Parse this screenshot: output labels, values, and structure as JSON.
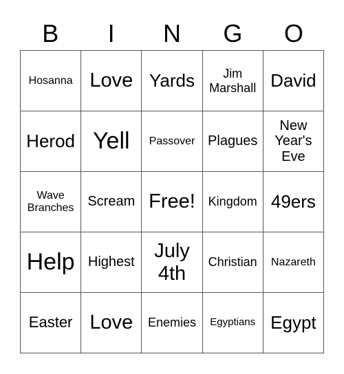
{
  "header": [
    "B",
    "I",
    "N",
    "G",
    "O"
  ],
  "grid": [
    [
      {
        "text": "Hosanna",
        "size": "s-xs"
      },
      {
        "text": "Love",
        "size": "s-l"
      },
      {
        "text": "Yards",
        "size": "s-lm"
      },
      {
        "text": "Jim Marshall",
        "size": "s-s"
      },
      {
        "text": "David",
        "size": "s-lm"
      }
    ],
    [
      {
        "text": "Herod",
        "size": "s-lm"
      },
      {
        "text": "Yell",
        "size": "s-xl"
      },
      {
        "text": "Passover",
        "size": "s-xs"
      },
      {
        "text": "Plagues",
        "size": "s-ms"
      },
      {
        "text": "New Year's Eve",
        "size": "s-ms"
      }
    ],
    [
      {
        "text": "Wave Branches",
        "size": "s-xs"
      },
      {
        "text": "Scream",
        "size": "s-ms"
      },
      {
        "text": "Free!",
        "size": "s-l"
      },
      {
        "text": "Kingdom",
        "size": "s-s"
      },
      {
        "text": "49ers",
        "size": "s-lm"
      }
    ],
    [
      {
        "text": "Help",
        "size": "s-xl"
      },
      {
        "text": "Highest",
        "size": "s-ms"
      },
      {
        "text": "July 4th",
        "size": "s-l"
      },
      {
        "text": "Christian",
        "size": "s-s"
      },
      {
        "text": "Nazareth",
        "size": "s-xs"
      }
    ],
    [
      {
        "text": "Easter",
        "size": "s-m"
      },
      {
        "text": "Love",
        "size": "s-l"
      },
      {
        "text": "Enemies",
        "size": "s-s"
      },
      {
        "text": "Egyptians",
        "size": "s-xxs"
      },
      {
        "text": "Egypt",
        "size": "s-lm"
      }
    ]
  ]
}
